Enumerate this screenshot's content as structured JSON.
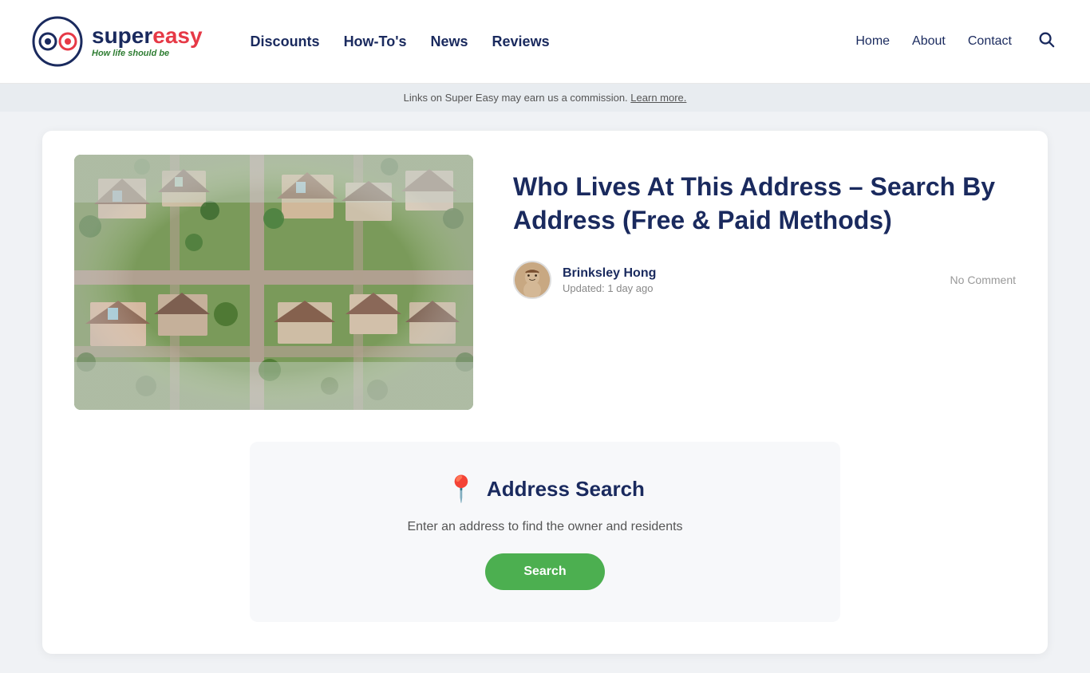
{
  "header": {
    "logo": {
      "super_text": "super",
      "easy_text": "easy",
      "tagline": "How life ",
      "tagline_emphasis": "should be"
    },
    "nav": {
      "items": [
        {
          "label": "Discounts",
          "href": "#"
        },
        {
          "label": "How-To's",
          "href": "#"
        },
        {
          "label": "News",
          "href": "#"
        },
        {
          "label": "Reviews",
          "href": "#"
        }
      ]
    },
    "right_nav": {
      "items": [
        {
          "label": "Home",
          "href": "#"
        },
        {
          "label": "About",
          "href": "#"
        },
        {
          "label": "Contact",
          "href": "#"
        }
      ]
    }
  },
  "commission_bar": {
    "text": "Links on Super Easy may earn us a commission.",
    "link_text": "Learn more."
  },
  "article": {
    "title": "Who Lives At This Address – Search By Address (Free & Paid Methods)",
    "author_name": "Brinksley Hong",
    "author_updated": "Updated: 1 day ago",
    "no_comment": "No Comment"
  },
  "address_widget": {
    "title": "Address Search",
    "subtitle": "Enter an address to find the owner and residents",
    "button_label": "Search"
  }
}
